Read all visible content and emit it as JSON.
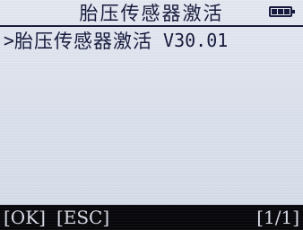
{
  "header": {
    "title": "胎压传感器激活",
    "battery_icon": "battery-full-icon"
  },
  "menu": {
    "items": [
      {
        "cursor": ">",
        "label": "胎压传感器激活",
        "version": "V30.01"
      }
    ]
  },
  "footer": {
    "ok_label": "[OK]",
    "esc_label": "[ESC]",
    "page_indicator": "[1/1]"
  },
  "colors": {
    "screen_bg": "#dde3ee",
    "text": "#14173a",
    "footer_bg": "#07070b",
    "footer_text": "#d7dae6"
  }
}
